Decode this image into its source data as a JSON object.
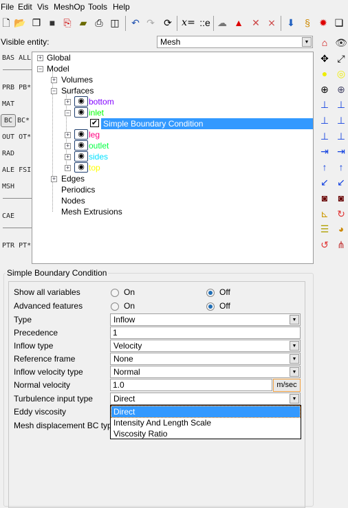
{
  "menu": [
    "File",
    "Edit",
    "Vis",
    "MeshOp",
    "Tools",
    "Help"
  ],
  "toolbar": {
    "icons": [
      "new-icon",
      "open-icon",
      "copy-icon",
      "save-icon",
      "export-icon",
      "folder-icon",
      "print-icon",
      "save-as-icon",
      "undo-icon",
      "redo-icon",
      "refresh-icon",
      "variable-icon",
      "constant-icon",
      "mesh-icon",
      "shapes-icon",
      "delete-shapes-icon",
      "delete-mesh-icon",
      "package-icon",
      "script-icon",
      "stop-icon",
      "window-icon"
    ],
    "variable_label": "x=",
    "constant_label": "::e"
  },
  "visible_entity": {
    "label": "Visible entity:",
    "value": "Mesh"
  },
  "left_labels": [
    "BAS ALL",
    "PRB PB*",
    "MAT",
    "BC",
    "BC*",
    "OUT OT*",
    "RAD",
    "ALE FSI",
    "MSH",
    "CAE",
    "PTR PT*"
  ],
  "tree": {
    "global": "Global",
    "model": "Model",
    "volumes": "Volumes",
    "surfaces": "Surfaces",
    "surface_items": [
      {
        "name": "bottom",
        "color": "#8000ff"
      },
      {
        "name": "inlet",
        "color": "#00ff00"
      },
      {
        "name": "leg",
        "color": "#ff0080"
      },
      {
        "name": "outlet",
        "color": "#00ff40"
      },
      {
        "name": "sides",
        "color": "#00e0ff"
      },
      {
        "name": "top",
        "color": "#ffff00"
      }
    ],
    "selected": "Simple Boundary Condition",
    "edges": "Edges",
    "periodics": "Periodics",
    "nodes": "Nodes",
    "mesh_extrusions": "Mesh Extrusions"
  },
  "panel": {
    "title": "Simple Boundary Condition",
    "show_all": {
      "label": "Show all variables",
      "on": "On",
      "off": "Off",
      "value": "Off"
    },
    "advanced": {
      "label": "Advanced features",
      "on": "On",
      "off": "Off",
      "value": "Off"
    },
    "type": {
      "label": "Type",
      "value": "Inflow"
    },
    "precedence": {
      "label": "Precedence",
      "value": "1"
    },
    "inflow_type": {
      "label": "Inflow type",
      "value": "Velocity"
    },
    "reference_frame": {
      "label": "Reference frame",
      "value": "None"
    },
    "inflow_velocity_type": {
      "label": "Inflow velocity type",
      "value": "Normal"
    },
    "normal_velocity": {
      "label": "Normal velocity",
      "value": "1.0",
      "unit": "m/sec"
    },
    "turbulence": {
      "label": "Turbulence input type",
      "value": "Direct",
      "options": [
        "Direct",
        "Intensity And Length Scale",
        "Viscosity Ratio"
      ]
    },
    "eddy_viscosity": {
      "label": "Eddy viscosity"
    },
    "mesh_displacement": {
      "label": "Mesh displacement BC type"
    }
  },
  "right_icons": [
    "home-icon",
    "eye-icon",
    "move-icon",
    "fit-icon",
    "circle-icon",
    "select-circle-icon",
    "zoom-icon",
    "target-icon",
    "view-yz-icon",
    "view-yz-rev-icon",
    "view-zx-icon",
    "view-zx-rev-icon",
    "view-xy-icon",
    "view-xy-rev-icon",
    "rotate-x-pos-icon",
    "rotate-x-neg-icon",
    "rotate-y-pos-icon",
    "rotate-y-neg-icon",
    "rotate-z-pos-icon",
    "rotate-z-neg-icon",
    "camera-icon",
    "camera-alt-icon",
    "axes-icon",
    "curve-icon",
    "notes-icon",
    "palette-icon",
    "reset-icon",
    "pivot-icon"
  ]
}
